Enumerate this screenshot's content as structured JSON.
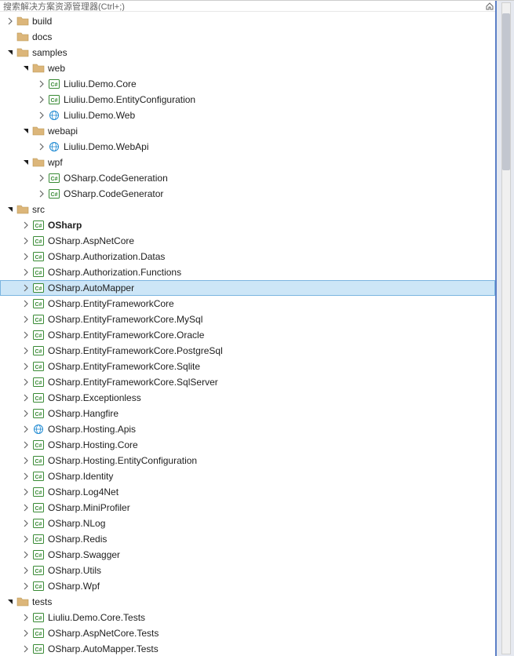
{
  "header": {
    "text": "搜索解决方案资源管理器(Ctrl+;)"
  },
  "tree": [
    {
      "indent": 0,
      "arrow": "collapsed",
      "icon": "folder",
      "label": "build"
    },
    {
      "indent": 0,
      "arrow": "none",
      "icon": "folder",
      "label": "docs"
    },
    {
      "indent": 0,
      "arrow": "expanded",
      "icon": "folder",
      "label": "samples"
    },
    {
      "indent": 1,
      "arrow": "expanded",
      "icon": "folder",
      "label": "web"
    },
    {
      "indent": 2,
      "arrow": "collapsed",
      "icon": "csproj",
      "label": "Liuliu.Demo.Core"
    },
    {
      "indent": 2,
      "arrow": "collapsed",
      "icon": "csproj",
      "label": "Liuliu.Demo.EntityConfiguration"
    },
    {
      "indent": 2,
      "arrow": "collapsed",
      "icon": "webproj",
      "label": "Liuliu.Demo.Web"
    },
    {
      "indent": 1,
      "arrow": "expanded",
      "icon": "folder",
      "label": "webapi"
    },
    {
      "indent": 2,
      "arrow": "collapsed",
      "icon": "webproj",
      "label": "Liuliu.Demo.WebApi"
    },
    {
      "indent": 1,
      "arrow": "expanded",
      "icon": "folder",
      "label": "wpf"
    },
    {
      "indent": 2,
      "arrow": "collapsed",
      "icon": "csproj",
      "label": "OSharp.CodeGeneration"
    },
    {
      "indent": 2,
      "arrow": "collapsed",
      "icon": "csproj",
      "label": "OSharp.CodeGenerator"
    },
    {
      "indent": 0,
      "arrow": "expanded",
      "icon": "folder",
      "label": "src"
    },
    {
      "indent": 1,
      "arrow": "collapsed",
      "icon": "csproj",
      "label": "OSharp",
      "bold": true
    },
    {
      "indent": 1,
      "arrow": "collapsed",
      "icon": "csproj",
      "label": "OSharp.AspNetCore"
    },
    {
      "indent": 1,
      "arrow": "collapsed",
      "icon": "csproj",
      "label": "OSharp.Authorization.Datas"
    },
    {
      "indent": 1,
      "arrow": "collapsed",
      "icon": "csproj",
      "label": "OSharp.Authorization.Functions"
    },
    {
      "indent": 1,
      "arrow": "collapsed",
      "icon": "csproj",
      "label": "OSharp.AutoMapper",
      "selected": true
    },
    {
      "indent": 1,
      "arrow": "collapsed",
      "icon": "csproj",
      "label": "OSharp.EntityFrameworkCore"
    },
    {
      "indent": 1,
      "arrow": "collapsed",
      "icon": "csproj",
      "label": "OSharp.EntityFrameworkCore.MySql"
    },
    {
      "indent": 1,
      "arrow": "collapsed",
      "icon": "csproj",
      "label": "OSharp.EntityFrameworkCore.Oracle"
    },
    {
      "indent": 1,
      "arrow": "collapsed",
      "icon": "csproj",
      "label": "OSharp.EntityFrameworkCore.PostgreSql"
    },
    {
      "indent": 1,
      "arrow": "collapsed",
      "icon": "csproj",
      "label": "OSharp.EntityFrameworkCore.Sqlite"
    },
    {
      "indent": 1,
      "arrow": "collapsed",
      "icon": "csproj",
      "label": "OSharp.EntityFrameworkCore.SqlServer"
    },
    {
      "indent": 1,
      "arrow": "collapsed",
      "icon": "csproj",
      "label": "OSharp.Exceptionless"
    },
    {
      "indent": 1,
      "arrow": "collapsed",
      "icon": "csproj",
      "label": "OSharp.Hangfire"
    },
    {
      "indent": 1,
      "arrow": "collapsed",
      "icon": "webproj",
      "label": "OSharp.Hosting.Apis"
    },
    {
      "indent": 1,
      "arrow": "collapsed",
      "icon": "csproj",
      "label": "OSharp.Hosting.Core"
    },
    {
      "indent": 1,
      "arrow": "collapsed",
      "icon": "csproj",
      "label": "OSharp.Hosting.EntityConfiguration"
    },
    {
      "indent": 1,
      "arrow": "collapsed",
      "icon": "csproj",
      "label": "OSharp.Identity"
    },
    {
      "indent": 1,
      "arrow": "collapsed",
      "icon": "csproj",
      "label": "OSharp.Log4Net"
    },
    {
      "indent": 1,
      "arrow": "collapsed",
      "icon": "csproj",
      "label": "OSharp.MiniProfiler"
    },
    {
      "indent": 1,
      "arrow": "collapsed",
      "icon": "csproj",
      "label": "OSharp.NLog"
    },
    {
      "indent": 1,
      "arrow": "collapsed",
      "icon": "csproj",
      "label": "OSharp.Redis"
    },
    {
      "indent": 1,
      "arrow": "collapsed",
      "icon": "csproj",
      "label": "OSharp.Swagger"
    },
    {
      "indent": 1,
      "arrow": "collapsed",
      "icon": "csproj",
      "label": "OSharp.Utils"
    },
    {
      "indent": 1,
      "arrow": "collapsed",
      "icon": "csproj",
      "label": "OSharp.Wpf"
    },
    {
      "indent": 0,
      "arrow": "expanded",
      "icon": "folder",
      "label": "tests"
    },
    {
      "indent": 1,
      "arrow": "collapsed",
      "icon": "csproj",
      "label": "Liuliu.Demo.Core.Tests"
    },
    {
      "indent": 1,
      "arrow": "collapsed",
      "icon": "csproj",
      "label": "OSharp.AspNetCore.Tests"
    },
    {
      "indent": 1,
      "arrow": "collapsed",
      "icon": "csproj",
      "label": "OSharp.AutoMapper.Tests"
    }
  ],
  "colors": {
    "selectionBg": "#cde6f7",
    "selectionBorder": "#7bb5e0",
    "folderFill": "#dcb67a",
    "csharpGreen": "#388a34",
    "webBlue": "#1f8ad2"
  }
}
